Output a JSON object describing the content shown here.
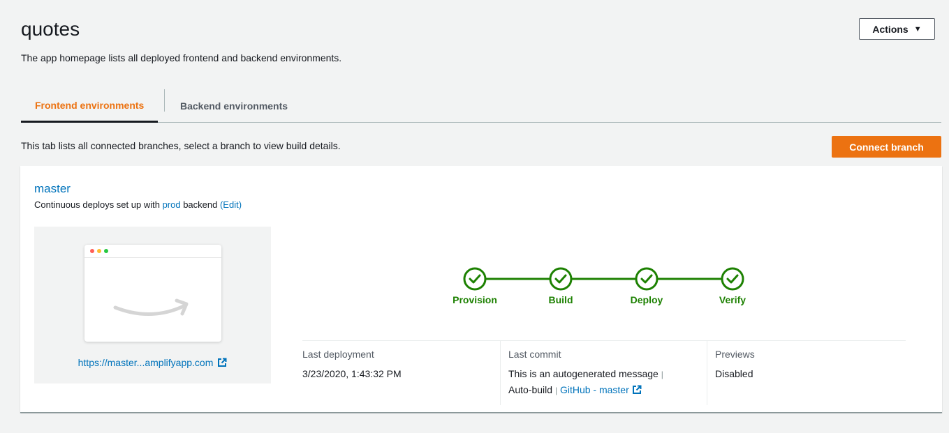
{
  "app": {
    "title": "quotes",
    "description": "The app homepage lists all deployed frontend and backend environments.",
    "actions_label": "Actions",
    "actions_icon": "caret-down-icon"
  },
  "tabs": [
    {
      "label": "Frontend environments",
      "active": true
    },
    {
      "label": "Backend environments",
      "active": false
    }
  ],
  "info": {
    "text": "This tab lists all connected branches, select a branch to view build details.",
    "connect_label": "Connect branch"
  },
  "branch": {
    "name": "master",
    "sub_prefix": "Continuous deploys set up with ",
    "backend_link": "prod",
    "sub_middle": " backend ",
    "edit_link": "(Edit)",
    "url": "https://master...amplifyapp.com"
  },
  "pipeline": {
    "steps": [
      "Provision",
      "Build",
      "Deploy",
      "Verify"
    ],
    "status": "succeeded",
    "color": "#1d8102"
  },
  "meta": {
    "last_deployment_label": "Last deployment",
    "last_deployment_value": "3/23/2020, 1:43:32 PM",
    "last_commit_label": "Last commit",
    "commit_message": "This is an autogenerated message",
    "commit_type": "Auto-build",
    "commit_link": "GitHub - master",
    "previews_label": "Previews",
    "previews_value": "Disabled"
  },
  "colors": {
    "accent": "#ec7211",
    "link": "#0073bb",
    "success": "#1d8102"
  }
}
